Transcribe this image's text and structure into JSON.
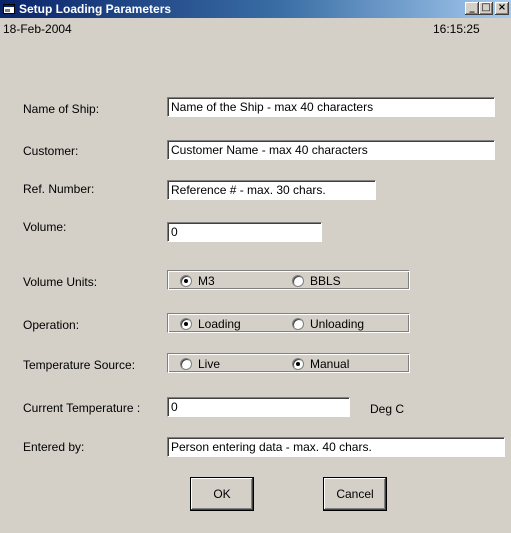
{
  "window": {
    "title": "Setup Loading Parameters"
  },
  "header": {
    "date": "18-Feb-2004",
    "time": "16:15:25"
  },
  "fields": {
    "ship_name": {
      "label": "Name of Ship:",
      "value": "Name of the Ship - max 40 characters"
    },
    "customer": {
      "label": "Customer:",
      "value": "Customer Name - max 40 characters"
    },
    "ref_number": {
      "label": "Ref. Number:",
      "value": "Reference # - max. 30 chars."
    },
    "volume": {
      "label": "Volume:",
      "value": "0"
    },
    "current_temperature": {
      "label": "Current Temperature :",
      "value": "0",
      "unit": "Deg C"
    },
    "entered_by": {
      "label": "Entered by:",
      "value": "Person entering data - max. 40 chars."
    }
  },
  "volume_units": {
    "label": "Volume Units:",
    "options": [
      "M3",
      "BBLS"
    ],
    "selected": "M3"
  },
  "operation": {
    "label": "Operation:",
    "options": [
      "Loading",
      "Unloading"
    ],
    "selected": "Loading"
  },
  "temperature_source": {
    "label": "Temperature Source:",
    "options": [
      "Live",
      "Manual"
    ],
    "selected": "Manual"
  },
  "buttons": {
    "ok": "OK",
    "cancel": "Cancel"
  }
}
